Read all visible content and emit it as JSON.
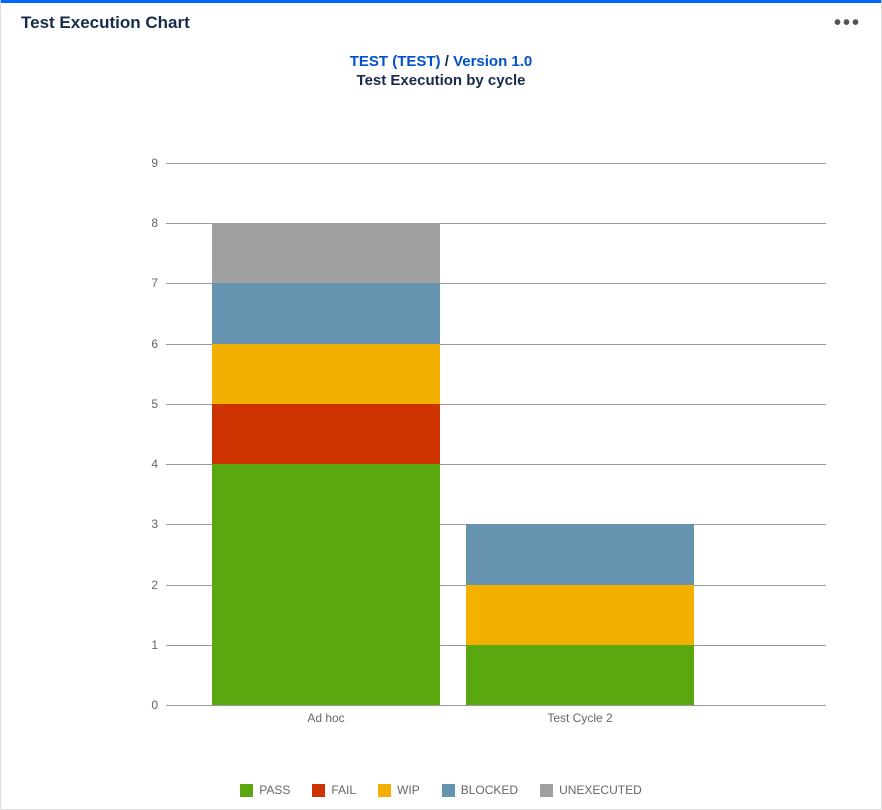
{
  "header": {
    "title": "Test Execution Chart"
  },
  "breadcrumb": {
    "project": "TEST (TEST)",
    "sep": "/",
    "version": "Version 1.0"
  },
  "subtitle": "Test Execution by cycle",
  "chart_data": {
    "type": "bar",
    "stacked": true,
    "categories": [
      "Ad hoc",
      "Test Cycle 2"
    ],
    "series": [
      {
        "name": "PASS",
        "color": "#59a80f",
        "values": [
          4,
          1
        ]
      },
      {
        "name": "FAIL",
        "color": "#cc3300",
        "values": [
          1,
          0
        ]
      },
      {
        "name": "WIP",
        "color": "#f2b000",
        "values": [
          1,
          1
        ]
      },
      {
        "name": "BLOCKED",
        "color": "#6693b0",
        "values": [
          1,
          1
        ]
      },
      {
        "name": "UNEXECUTED",
        "color": "#a0a0a0",
        "values": [
          1,
          0
        ]
      }
    ],
    "ylim": [
      0,
      9
    ],
    "y_ticks": [
      0,
      1,
      2,
      3,
      4,
      5,
      6,
      7,
      8,
      9
    ],
    "xlabel": "",
    "ylabel": "",
    "title": "Test Execution by cycle"
  }
}
